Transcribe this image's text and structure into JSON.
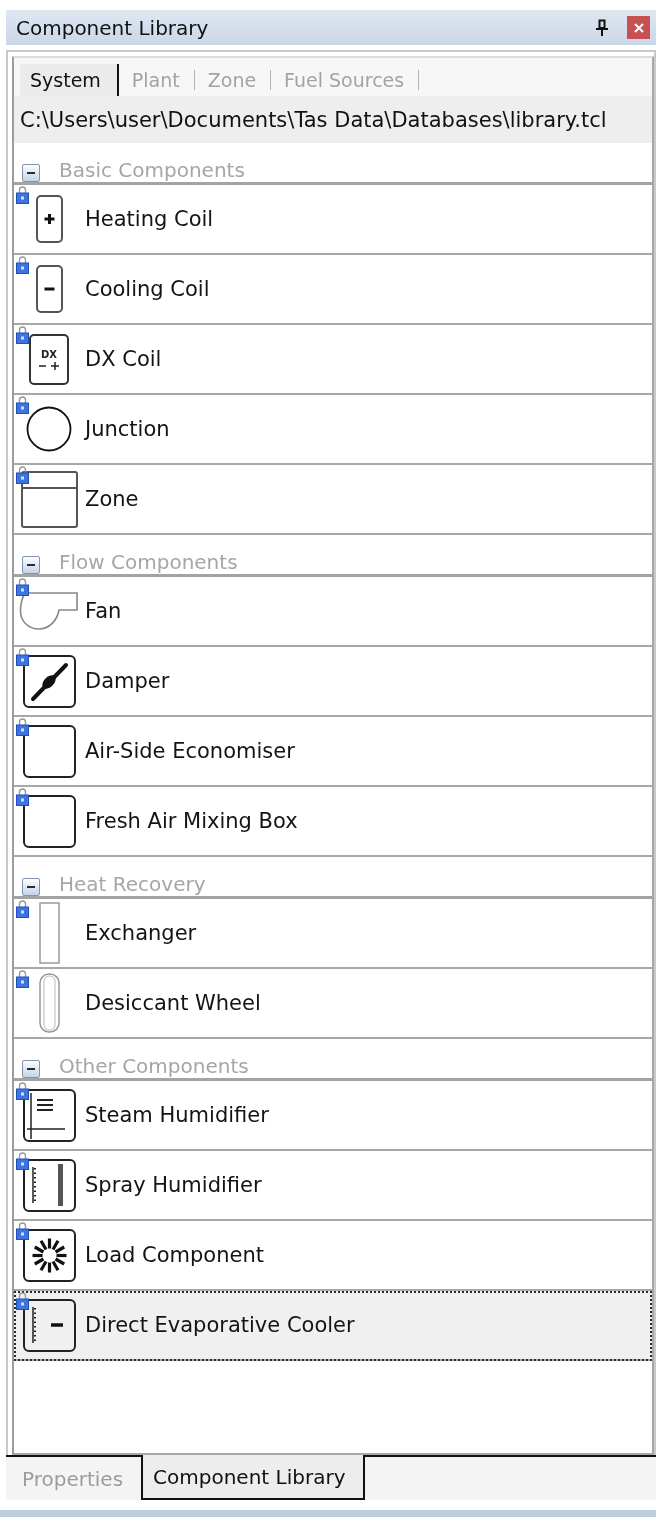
{
  "panel": {
    "title": "Component Library"
  },
  "tabs": [
    {
      "label": "System",
      "selected": true
    },
    {
      "label": "Plant",
      "selected": false
    },
    {
      "label": "Zone",
      "selected": false
    },
    {
      "label": "Fuel Sources",
      "selected": false
    }
  ],
  "path": "C:\\Users\\user\\Documents\\Tas Data\\Databases\\library.tcl",
  "groups": [
    {
      "title": "Basic Components",
      "expanded": true,
      "items": [
        {
          "name": "Heating Coil",
          "kind": "plus",
          "locked": true,
          "selected": false
        },
        {
          "name": "Cooling Coil",
          "kind": "minus",
          "locked": true,
          "selected": false
        },
        {
          "name": "DX Coil",
          "kind": "dx",
          "icon_text": "DX",
          "locked": true,
          "selected": false
        },
        {
          "name": "Junction",
          "kind": "circle",
          "locked": true,
          "selected": false
        },
        {
          "name": "Zone",
          "kind": "window",
          "locked": true,
          "selected": false
        }
      ]
    },
    {
      "title": "Flow Components",
      "expanded": true,
      "items": [
        {
          "name": "Fan",
          "kind": "fan",
          "locked": true,
          "selected": false
        },
        {
          "name": "Damper",
          "kind": "damper",
          "locked": true,
          "selected": false
        },
        {
          "name": "Air-Side Economiser",
          "kind": "square",
          "locked": true,
          "selected": false
        },
        {
          "name": "Fresh Air Mixing Box",
          "kind": "square",
          "locked": true,
          "selected": false
        }
      ]
    },
    {
      "title": "Heat Recovery",
      "expanded": true,
      "items": [
        {
          "name": "Exchanger",
          "kind": "slab",
          "locked": true,
          "selected": false
        },
        {
          "name": "Desiccant Wheel",
          "kind": "wheel",
          "locked": true,
          "selected": false
        }
      ]
    },
    {
      "title": "Other Components",
      "expanded": true,
      "items": [
        {
          "name": "Steam Humidifier",
          "kind": "steam",
          "locked": true,
          "selected": false
        },
        {
          "name": "Spray Humidifier",
          "kind": "spray",
          "locked": true,
          "selected": false
        },
        {
          "name": "Load Component",
          "kind": "burst",
          "locked": true,
          "selected": false
        },
        {
          "name": "Direct Evaporative Cooler",
          "kind": "evaporative",
          "locked": true,
          "selected": true
        }
      ]
    }
  ],
  "bottom_tabs": [
    {
      "label": "Properties",
      "selected": false
    },
    {
      "label": "Component Library",
      "selected": true
    }
  ]
}
